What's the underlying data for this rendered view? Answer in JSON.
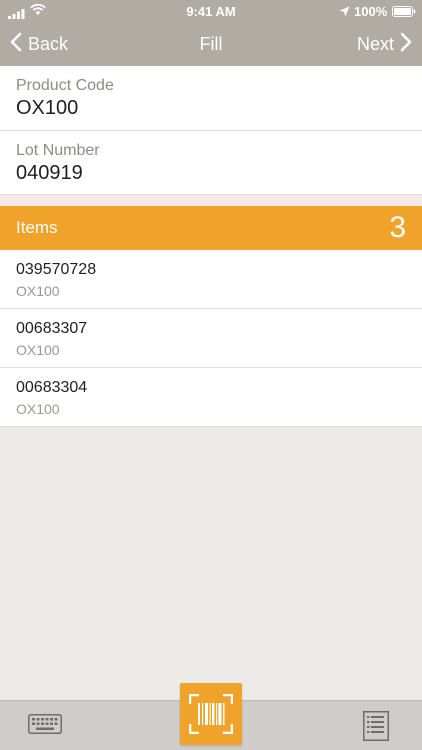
{
  "status": {
    "time": "9:41 AM",
    "battery": "100%"
  },
  "nav": {
    "back_label": "Back",
    "title": "Fill",
    "next_label": "Next"
  },
  "fields": {
    "product": {
      "label": "Product Code",
      "value": "OX100"
    },
    "lot": {
      "label": "Lot Number",
      "value": "040919"
    }
  },
  "items_header": {
    "label": "Items",
    "count": "3"
  },
  "items": [
    {
      "code": "039570728",
      "product": "OX100"
    },
    {
      "code": "00683307",
      "product": "OX100"
    },
    {
      "code": "00683304",
      "product": "OX100"
    }
  ],
  "colors": {
    "accent": "#f0a32a",
    "nav_bar": "#b0aca4",
    "background": "#ecebe7"
  },
  "icons": {
    "left": "keyboard-icon",
    "center": "barcode-scan-icon",
    "right": "list-icon"
  }
}
